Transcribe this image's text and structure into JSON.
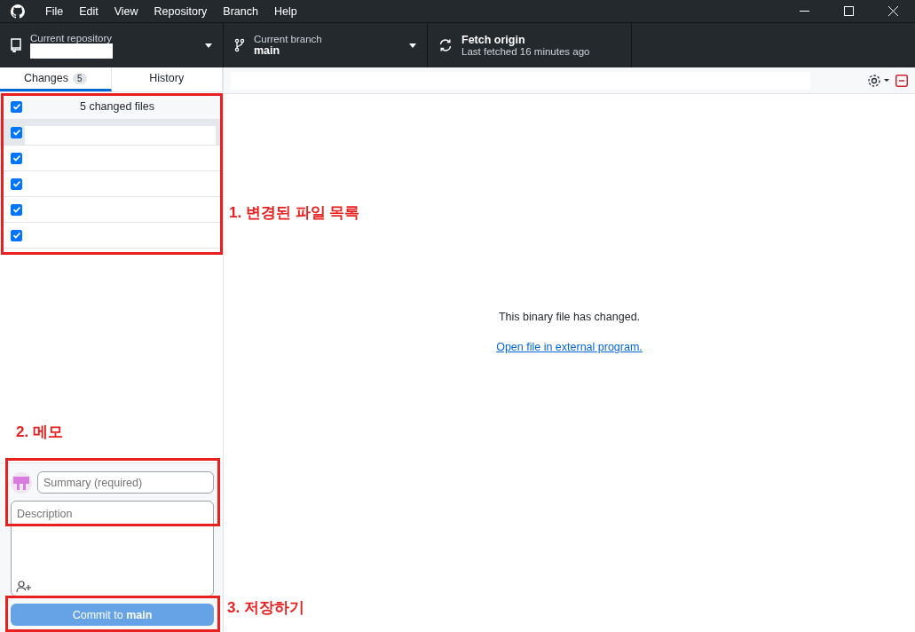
{
  "menu": [
    "File",
    "Edit",
    "View",
    "Repository",
    "Branch",
    "Help"
  ],
  "toolbar": {
    "repository": {
      "label": "Current repository"
    },
    "branch": {
      "label": "Current branch",
      "value": "main"
    },
    "fetch": {
      "title": "Fetch origin",
      "subtitle": "Last fetched 16 minutes ago"
    }
  },
  "tabs": [
    {
      "label": "Changes",
      "count": "5",
      "selected": true
    },
    {
      "label": "History",
      "selected": false
    }
  ],
  "changes": {
    "header": "5 changed files",
    "all_checked": true,
    "files": [
      {
        "checked": true,
        "selected": true
      },
      {
        "checked": true,
        "selected": false
      },
      {
        "checked": true,
        "selected": false
      },
      {
        "checked": true,
        "selected": false
      },
      {
        "checked": true,
        "selected": false
      }
    ]
  },
  "commit": {
    "summary": {
      "placeholder": "Summary (required)"
    },
    "description": {
      "placeholder": "Description"
    },
    "button": {
      "label": "Commit to **main**",
      "disabled": true
    }
  },
  "diff": {
    "message": "This binary file has changed.",
    "link": "Open file in external program."
  },
  "annotations": [
    {
      "label": "1. 변경된 파일 목록"
    },
    {
      "label": "2. 메모"
    },
    {
      "label": "3. 저장하기"
    }
  ]
}
